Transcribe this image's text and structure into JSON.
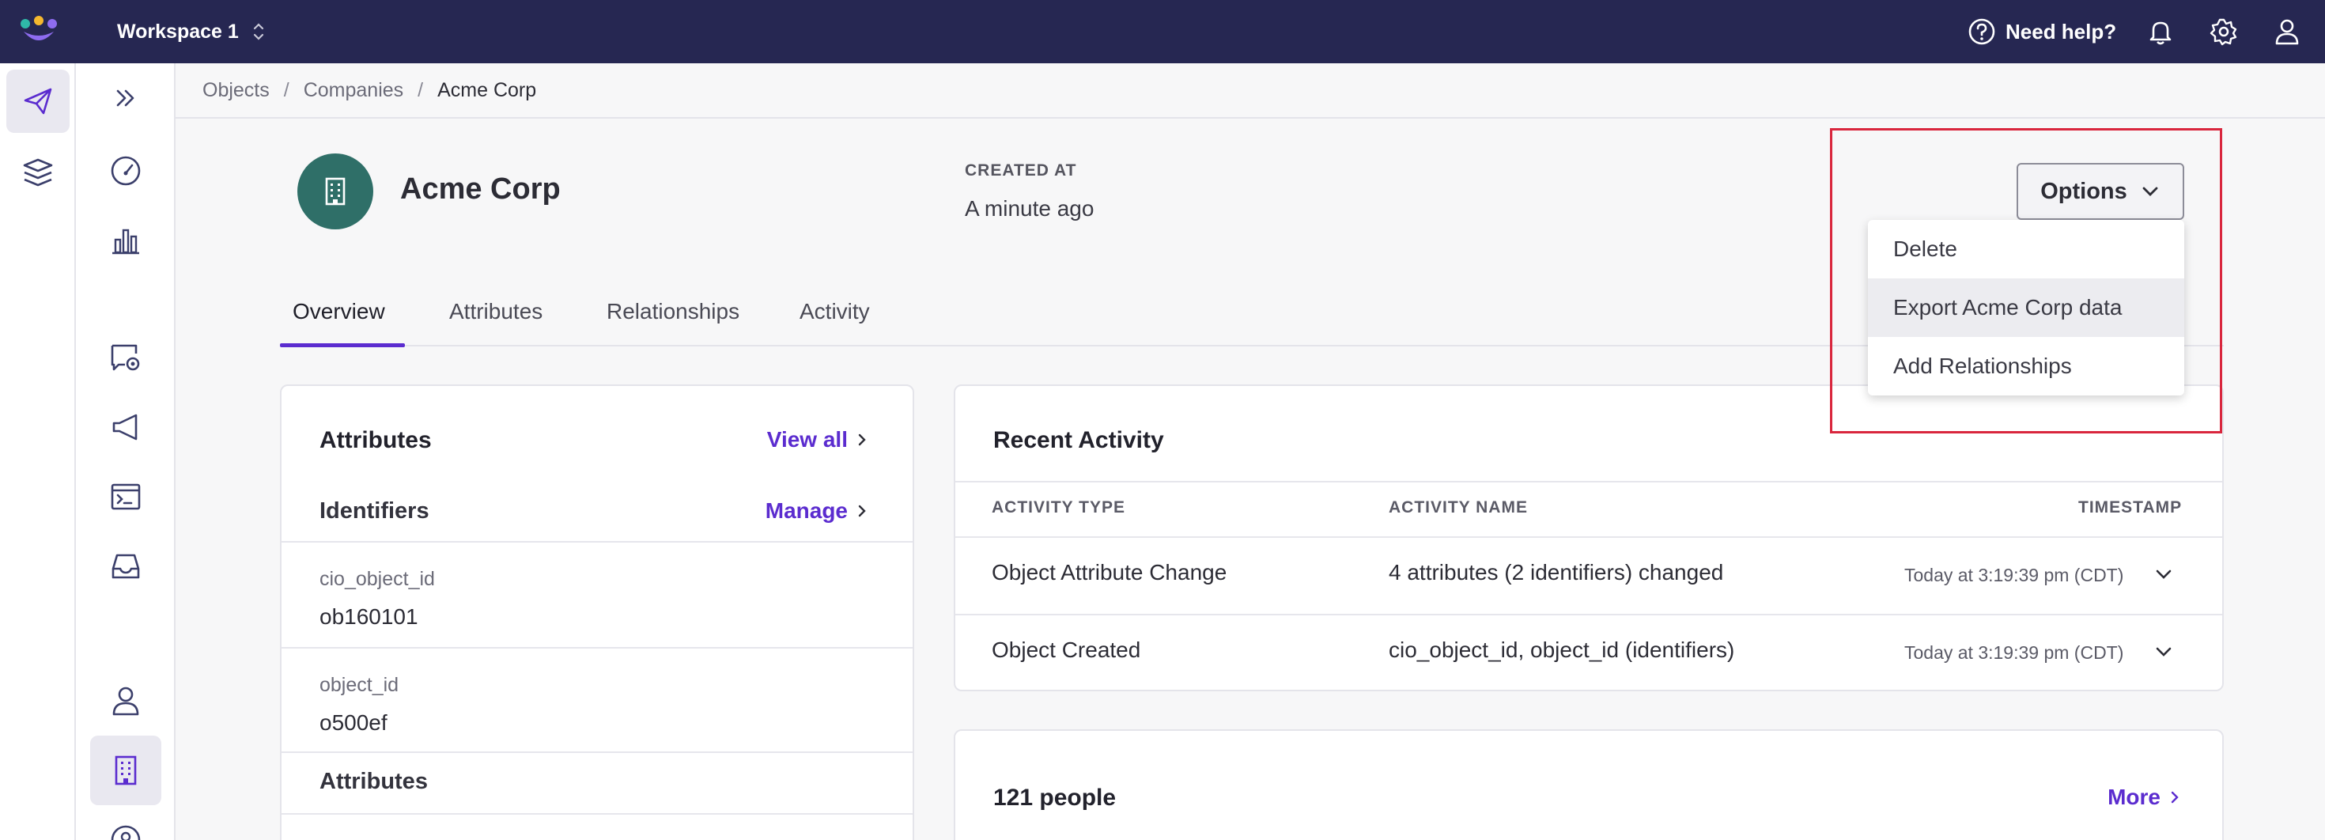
{
  "topbar": {
    "workspace": "Workspace 1",
    "help_label": "Need help?"
  },
  "breadcrumbs": [
    "Objects",
    "Companies",
    "Acme Corp"
  ],
  "header": {
    "title": "Acme Corp",
    "created_label": "CREATED AT",
    "created_value": "A minute ago"
  },
  "tabs": [
    "Overview",
    "Attributes",
    "Relationships",
    "Activity"
  ],
  "options": {
    "button_label": "Options",
    "items": [
      "Delete",
      "Export Acme Corp data",
      "Add Relationships"
    ]
  },
  "attributes_card": {
    "title": "Attributes",
    "view_all": "View all",
    "identifiers_title": "Identifiers",
    "manage": "Manage",
    "fields": [
      {
        "label": "cio_object_id",
        "value": "ob160101"
      },
      {
        "label": "object_id",
        "value": "o500ef"
      }
    ],
    "attributes_title": "Attributes"
  },
  "activity_card": {
    "title": "Recent Activity",
    "columns": [
      "ACTIVITY TYPE",
      "ACTIVITY NAME",
      "TIMESTAMP"
    ],
    "rows": [
      {
        "type": "Object Attribute Change",
        "name": "4 attributes (2 identifiers) changed",
        "timestamp": "Today at 3:19:39 pm (CDT)"
      },
      {
        "type": "Object Created",
        "name": "cio_object_id, object_id (identifiers)",
        "timestamp": "Today at 3:19:39 pm (CDT)"
      }
    ]
  },
  "people_card": {
    "title": "121 people",
    "more": "More"
  },
  "colors": {
    "topbar": "#262752",
    "accent": "#5b2ccf",
    "avatar": "#2f6f68",
    "highlight": "#d9263d"
  }
}
